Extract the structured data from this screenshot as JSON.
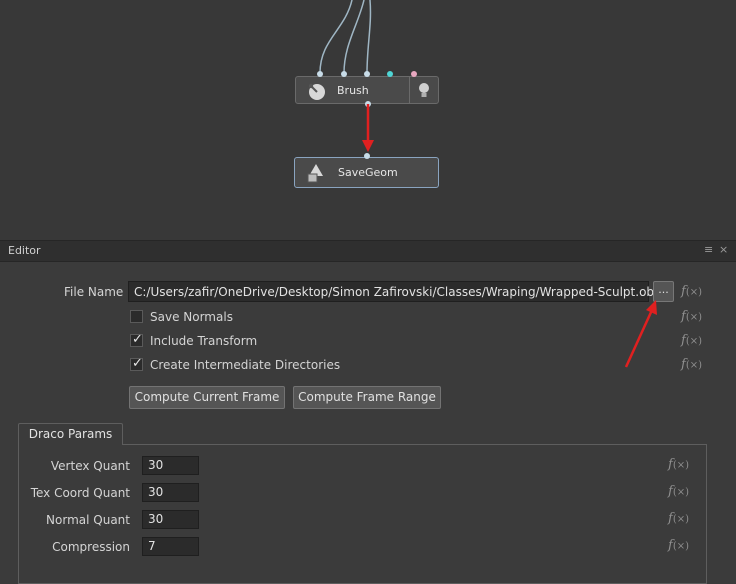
{
  "graph": {
    "nodes": {
      "brush": {
        "label": "Brush",
        "icon": "sphere-brush-icon",
        "toggle_icon": "lightbulb-icon"
      },
      "savegeom": {
        "label": "SaveGeom",
        "icon": "save-geometry-icon"
      }
    },
    "port_colors": {
      "default": "#c8dce8",
      "cyan": "#4fd6d6",
      "pink": "#e8a8c0"
    },
    "wire_color": "#9fb6c4"
  },
  "editor": {
    "title": "Editor",
    "menu_icon": "≡",
    "close_icon": "×",
    "file_name": {
      "label": "File Name",
      "value": "C:/Users/zafir/OneDrive/Desktop/Simon Zafirovski/Classes/Wraping/Wrapped-Sculpt.obj",
      "browse_label": "..."
    },
    "checkboxes": [
      {
        "label": "Save Normals",
        "checked": false
      },
      {
        "label": "Include Transform",
        "checked": true
      },
      {
        "label": "Create Intermediate Directories",
        "checked": true
      }
    ],
    "buttons": {
      "compute_current": "Compute Current Frame",
      "compute_range": "Compute Frame Range"
    },
    "tab": {
      "label": "Draco Params"
    },
    "draco_params": [
      {
        "label": "Vertex Quant",
        "value": "30"
      },
      {
        "label": "Tex Coord Quant",
        "value": "30"
      },
      {
        "label": "Normal Quant",
        "value": "30"
      },
      {
        "label": "Compression",
        "value": "7"
      }
    ],
    "fx_label": "f",
    "fx_arg": "(×)"
  },
  "annotation_color": "#e02020"
}
